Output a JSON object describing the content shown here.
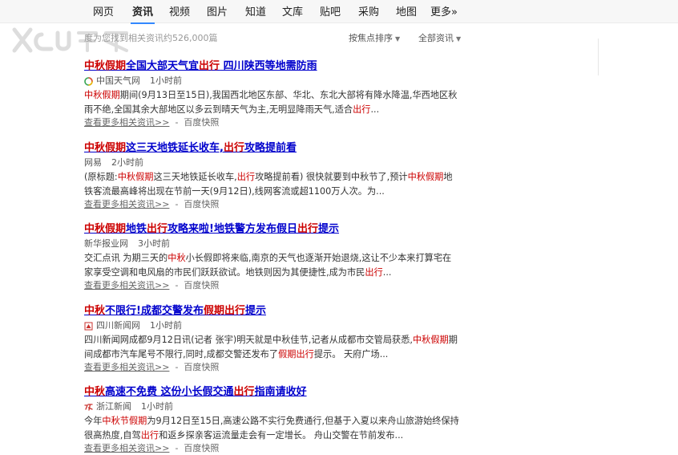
{
  "tabs": [
    {
      "label": "网页"
    },
    {
      "label": "资讯",
      "active": true
    },
    {
      "label": "视频"
    },
    {
      "label": "图片"
    },
    {
      "label": "知道"
    },
    {
      "label": "文库"
    },
    {
      "label": "贴吧"
    },
    {
      "label": "采购"
    },
    {
      "label": "地图"
    },
    {
      "label": "更多»"
    }
  ],
  "watermark": {
    "text": "X 车 U 快乐"
  },
  "result_count": "度为您找到相关资讯约526,000篇",
  "sort": {
    "focus": "按焦点排序",
    "all": "全部资讯"
  },
  "colors": {
    "link": "#0000cc",
    "highlight": "#cc0000",
    "tab_underline": "#3388ff"
  },
  "results": [
    {
      "title": [
        {
          "t": "中秋假期",
          "h": true
        },
        {
          "t": "全国大部天气宜",
          "h": false
        },
        {
          "t": "出行",
          "h": true
        },
        {
          "t": " 四川陕西等地需防雨",
          "h": false
        }
      ],
      "source": "中国天气网",
      "source_icon": "weather-logo-icon",
      "time": "1小时前",
      "abstract": [
        [
          {
            "t": "中秋假期",
            "h": true
          },
          {
            "t": "期间(9月13日至15日),我国西北地区东部、华北、东北大部将有降水降温,华西地区秋",
            "h": false
          }
        ],
        [
          {
            "t": "雨不绝,全国其余大部地区以多云到晴天气为主,无明显降雨天气,适合",
            "h": false
          },
          {
            "t": "出行",
            "h": true
          },
          {
            "t": "...",
            "h": false
          }
        ]
      ],
      "more": "查看更多相关资讯>>",
      "cache": "百度快照"
    },
    {
      "title": [
        {
          "t": "中秋假期",
          "h": true
        },
        {
          "t": "这三天地铁延长收车,",
          "h": false
        },
        {
          "t": "出行",
          "h": true
        },
        {
          "t": "攻略提前看",
          "h": false
        }
      ],
      "source": "网易",
      "source_icon": "",
      "time": "2小时前",
      "abstract": [
        [
          {
            "t": "(原标题:",
            "h": false
          },
          {
            "t": "中秋假期",
            "h": true
          },
          {
            "t": "这三天地铁延长收车,",
            "h": false
          },
          {
            "t": "出行",
            "h": true
          },
          {
            "t": "攻略提前看) 很快就要到中秋节了,预计",
            "h": false
          },
          {
            "t": "中秋假期",
            "h": true
          },
          {
            "t": "地",
            "h": false
          }
        ],
        [
          {
            "t": "铁客流最高峰将出现在节前一天(9月12日),线网客流或超1100万人次。为...",
            "h": false
          }
        ]
      ],
      "more": "查看更多相关资讯>>",
      "cache": "百度快照"
    },
    {
      "title": [
        {
          "t": "中秋假期",
          "h": true
        },
        {
          "t": "地铁",
          "h": false
        },
        {
          "t": "出行",
          "h": true
        },
        {
          "t": "攻略来啦!地铁警方发布假日",
          "h": false
        },
        {
          "t": "出行",
          "h": true
        },
        {
          "t": "提示",
          "h": false
        }
      ],
      "source": "新华报业网",
      "source_icon": "",
      "time": "3小时前",
      "abstract": [
        [
          {
            "t": "交汇点讯 为期三天的",
            "h": false
          },
          {
            "t": "中秋",
            "h": true
          },
          {
            "t": "小长假即将来临,南京的天气也逐渐开始退烧,这让不少本来打算宅在",
            "h": false
          }
        ],
        [
          {
            "t": "家享受空调和电风扇的市民们跃跃欲试。地铁则因为其便捷性,成为市民",
            "h": false
          },
          {
            "t": "出行",
            "h": true
          },
          {
            "t": "...",
            "h": false
          }
        ]
      ],
      "more": "查看更多相关资讯>>",
      "cache": "百度快照"
    },
    {
      "title": [
        {
          "t": "中秋",
          "h": true
        },
        {
          "t": "不限行!成都交警发布",
          "h": false
        },
        {
          "t": "假期出行",
          "h": true
        },
        {
          "t": "提示",
          "h": false
        }
      ],
      "source": "四川新闻网",
      "source_icon": "sichuan-news-logo-icon",
      "time": "1小时前",
      "abstract": [
        [
          {
            "t": "四川新闻网成都9月12日讯(记者 张宇)明天就是中秋佳节,记者从成都市交管局获悉,",
            "h": false
          },
          {
            "t": "中秋假期",
            "h": true
          },
          {
            "t": "期",
            "h": false
          }
        ],
        [
          {
            "t": "间成都市汽车尾号不限行,同时,成都交警还发布了",
            "h": false
          },
          {
            "t": "假期出行",
            "h": true
          },
          {
            "t": "提示。 天府广场...",
            "h": false
          }
        ]
      ],
      "more": "查看更多相关资讯>>",
      "cache": "百度快照"
    },
    {
      "title": [
        {
          "t": "中秋",
          "h": true
        },
        {
          "t": "高速不免费 这份小长假交通",
          "h": false
        },
        {
          "t": "出行",
          "h": true
        },
        {
          "t": "指南请收好",
          "h": false
        }
      ],
      "source": "浙江新闻",
      "source_icon": "zhejiang-news-logo-icon",
      "time": "1小时前",
      "abstract": [
        [
          {
            "t": "今年",
            "h": false
          },
          {
            "t": "中秋节假期",
            "h": true
          },
          {
            "t": "为9月12日至15日,高速公路不实行免费通行,但基于入夏以来舟山旅游始终保持",
            "h": false
          }
        ],
        [
          {
            "t": "很高热度,自驾",
            "h": false
          },
          {
            "t": "出行",
            "h": true
          },
          {
            "t": "和返乡探亲客运流量走会有一定增长。 舟山交警在节前发布...",
            "h": false
          }
        ]
      ],
      "more": "查看更多相关资讯>>",
      "cache": "百度快照"
    }
  ]
}
